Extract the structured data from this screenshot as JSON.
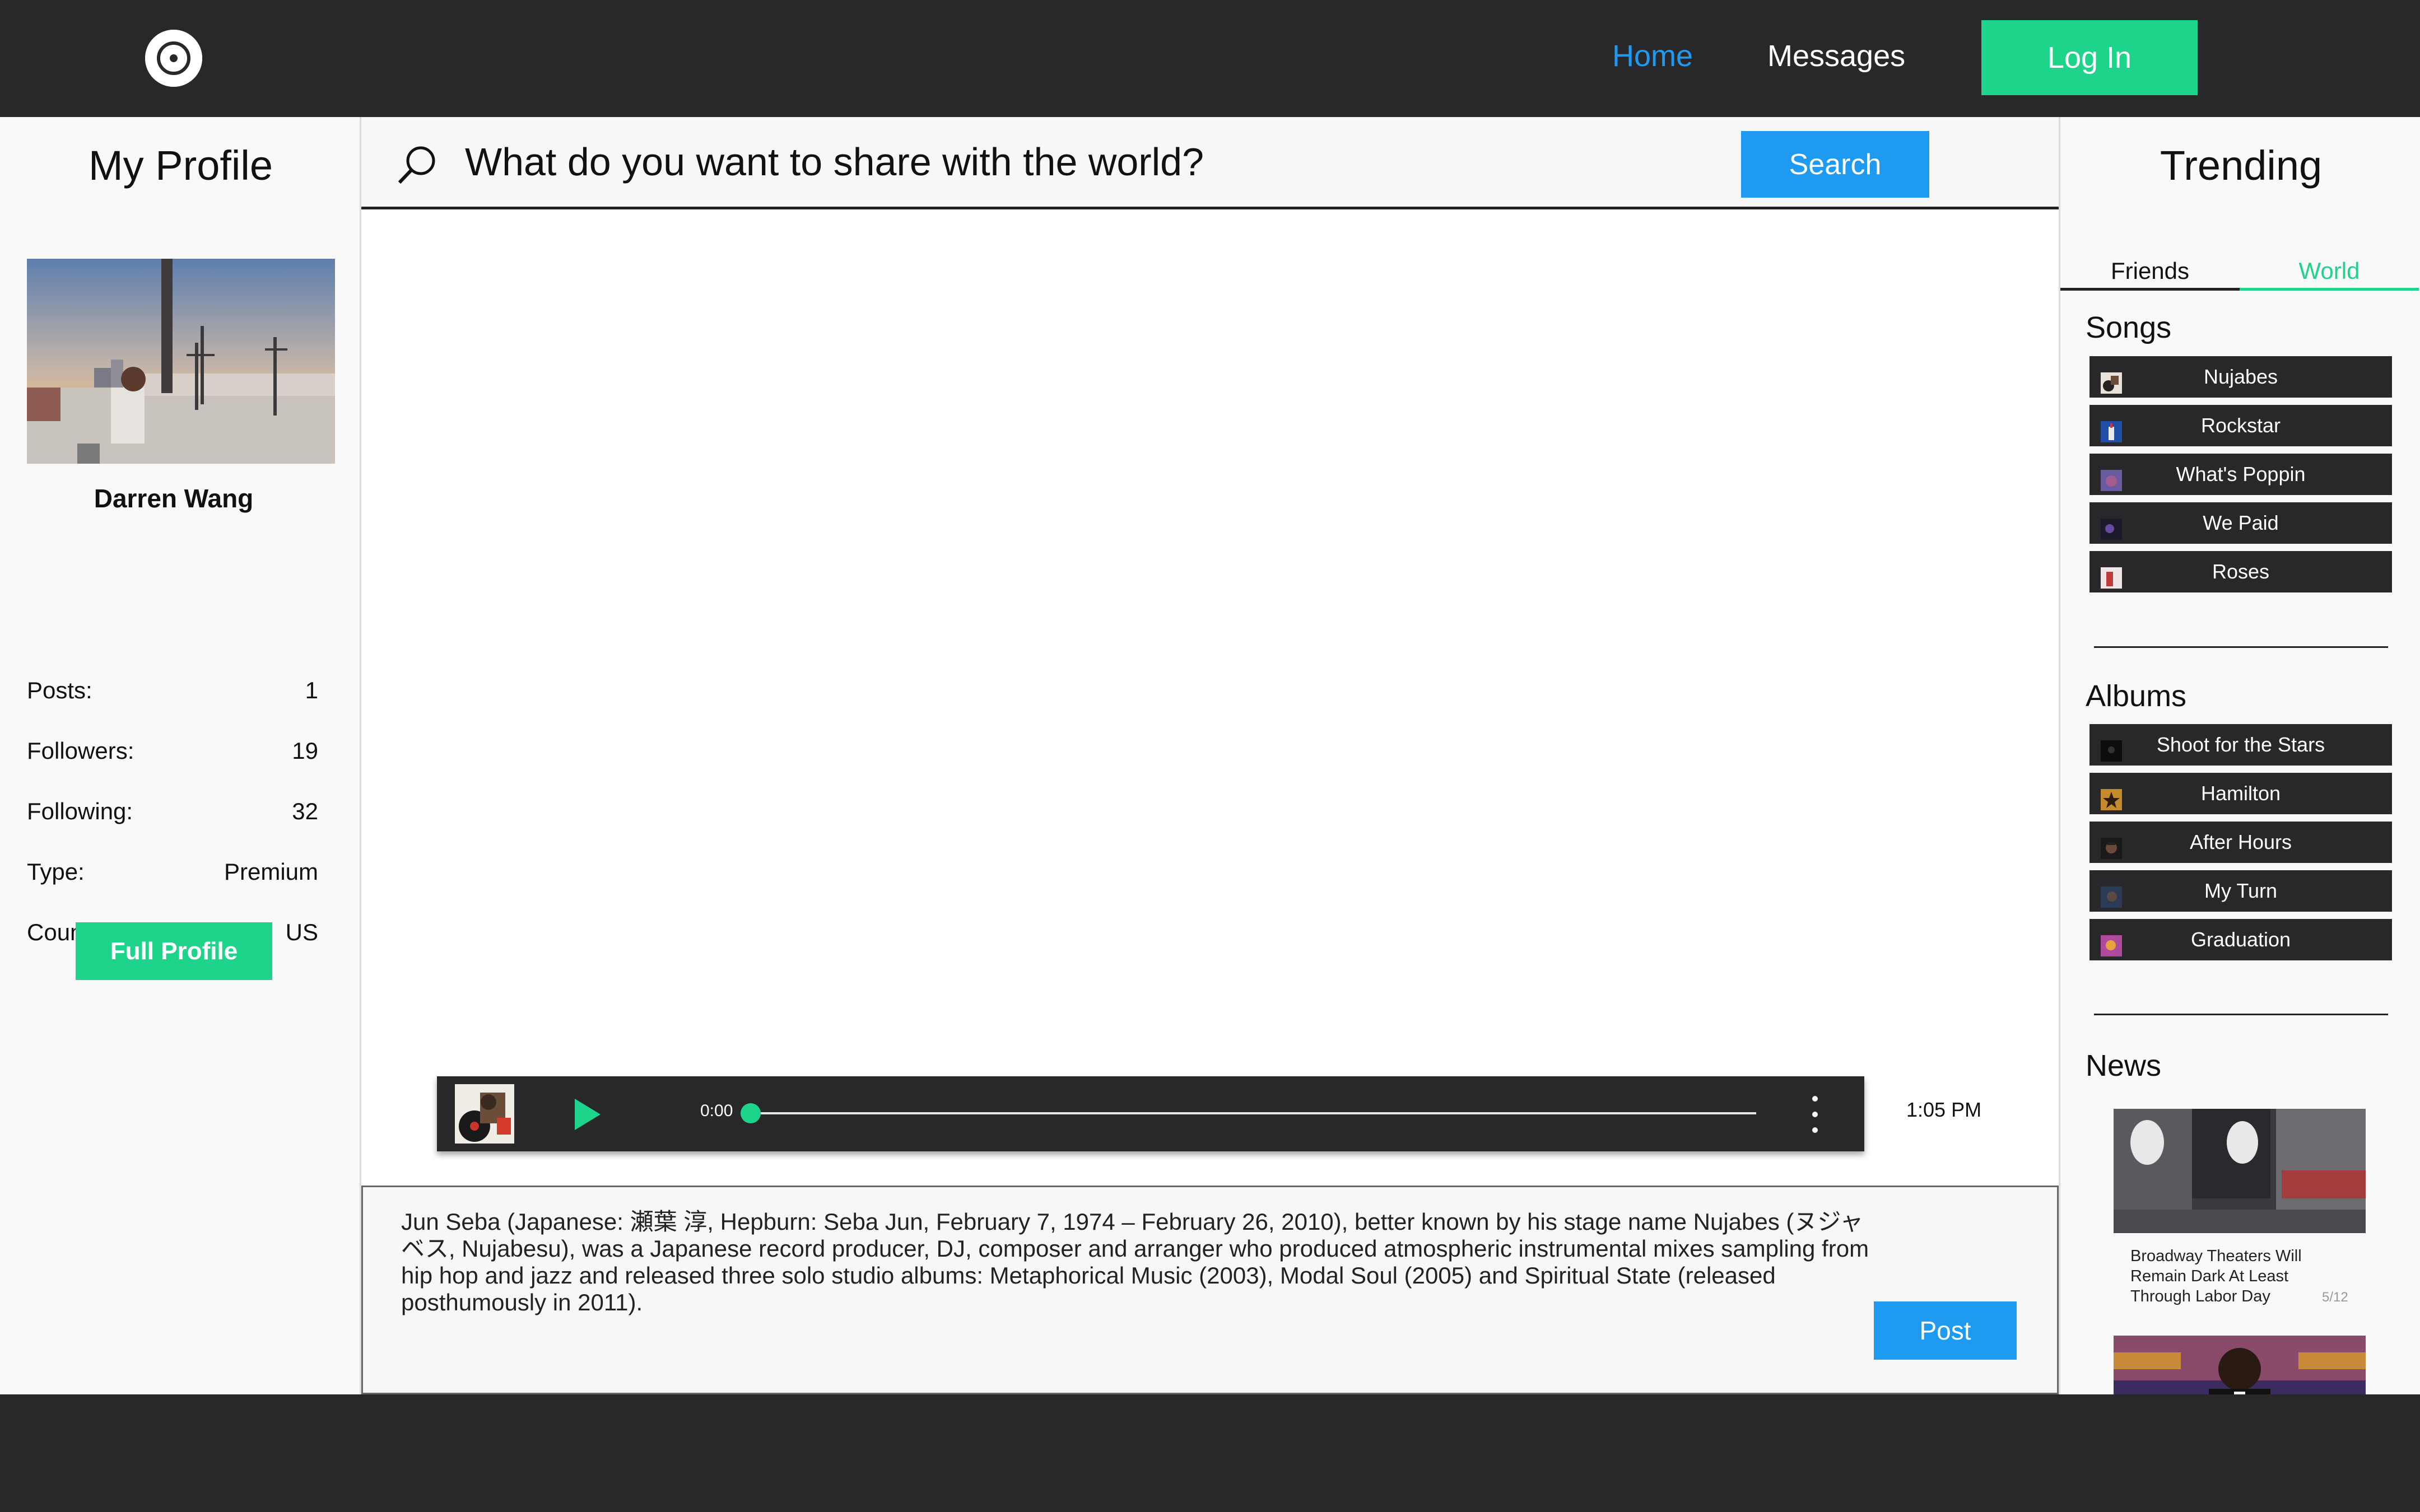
{
  "nav": {
    "home": "Home",
    "messages": "Messages",
    "login": "Log In"
  },
  "profile": {
    "title": "My Profile",
    "name": "Darren Wang",
    "stats": [
      {
        "label": "Posts:",
        "value": "1"
      },
      {
        "label": "Followers:",
        "value": "19"
      },
      {
        "label": "Following:",
        "value": "32"
      },
      {
        "label": "Type:",
        "value": "Premium"
      },
      {
        "label": "Country:",
        "value": "US"
      }
    ],
    "full_profile_button": "Full Profile"
  },
  "search": {
    "placeholder": "What do you want to share with the world?",
    "button": "Search"
  },
  "player": {
    "current_time": "0:00",
    "progress": 0
  },
  "post": {
    "time": "1:05 PM",
    "text": "Jun Seba (Japanese: 瀬葉 淳, Hepburn: Seba Jun, February 7, 1974 – February 26, 2010), better known by his stage name Nujabes (ヌジャベス, Nujabesu), was a Japanese record producer, DJ, composer and arranger who produced atmospheric instrumental mixes sampling from hip hop and jazz and released three solo studio albums: Metaphorical Music (2003), Modal Soul (2005) and Spiritual State (released posthumously in 2011).",
    "button": "Post"
  },
  "trending": {
    "title": "Trending",
    "tabs": [
      "Friends",
      "World"
    ],
    "active_tab": "World",
    "songs_title": "Songs",
    "songs": [
      "Nujabes",
      "Rockstar",
      "What's Poppin",
      "We Paid",
      "Roses"
    ],
    "albums_title": "Albums",
    "albums": [
      "Shoot for the Stars",
      "Hamilton",
      "After Hours",
      "My Turn",
      "Graduation"
    ],
    "news_title": "News",
    "news": [
      {
        "headline": "Broadway Theaters Will Remain Dark At Least Through Labor Day",
        "date": "5/12"
      }
    ]
  },
  "colors": {
    "accent_blue": "#1e9bf0",
    "accent_green": "#1ed38a",
    "dark": "#28282b"
  }
}
